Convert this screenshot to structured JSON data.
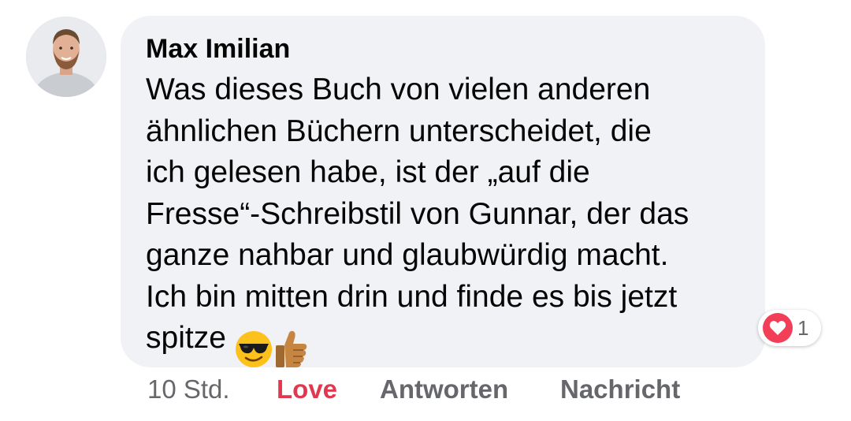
{
  "comment": {
    "author": "Max Imilian",
    "text": "Was dieses Buch von vielen anderen\nähnlichen Büchern unterscheidet, die\nich gelesen habe, ist der „auf die\nFresse“-Schreibstil von Gunnar, der das\nganze nahbar und glaubwürdig macht.\nIch bin mitten drin und finde es bis jetzt\nspitze",
    "emojis": [
      "sunglasses-face-emoji",
      "thumbs-up-emoji"
    ]
  },
  "reactions": {
    "icon": "heart-icon",
    "count": "1"
  },
  "actions": {
    "time": "10 Std.",
    "love": "Love",
    "reply": "Antworten",
    "message": "Nachricht"
  },
  "colors": {
    "bubble": "#f0f2f5",
    "love": "#e0394f",
    "muted": "#65676b",
    "heart": "#f33e58"
  }
}
